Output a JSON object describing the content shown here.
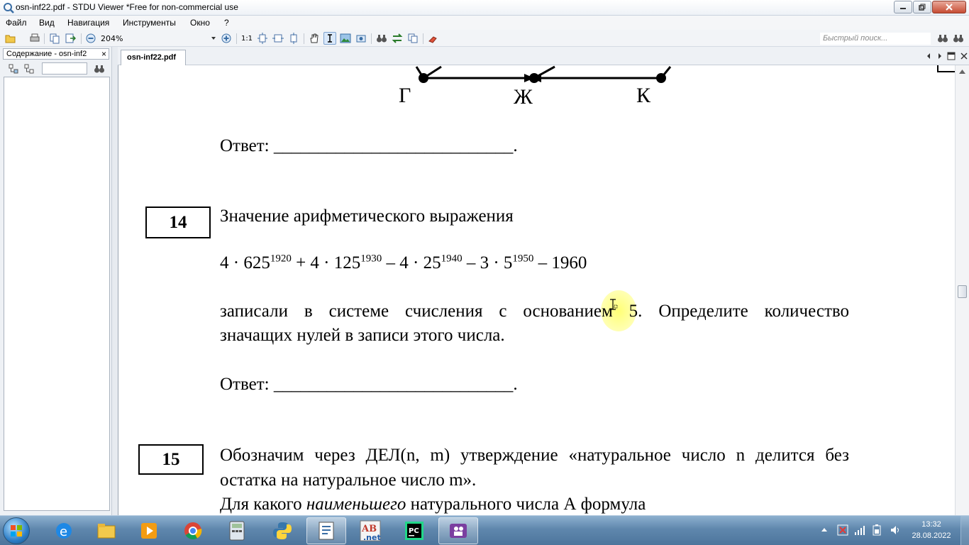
{
  "window": {
    "title": "osn-inf22.pdf - STDU Viewer *Free for non-commercial use"
  },
  "menu": {
    "items": [
      "Файл",
      "Вид",
      "Навигация",
      "Инструменты",
      "Окно",
      "?"
    ]
  },
  "toolbar": {
    "zoom": "204%",
    "actual_size": "1:1",
    "search_placeholder": "Быстрый поиск..."
  },
  "sidebar": {
    "tab_label": "Содержание - osn-inf2"
  },
  "document": {
    "tab_label": "osn-inf22.pdf",
    "graph_labels": [
      "Г",
      "Ж",
      "К"
    ],
    "answer_label_1": "Ответ: ",
    "answer_line_1": "___________________________.",
    "task14": {
      "number": "14",
      "title": "Значение арифметического выражения",
      "expr": {
        "p1": "4 · 625",
        "e1": "1920",
        "p2": " + 4 · 125",
        "e2": "1930",
        "p3": " – 4 · 25",
        "e3": "1940",
        "p4": " – 3 · 5",
        "e4": "1950",
        "p5": " – 1960"
      },
      "line1": "записали в системе счисления с основанием 5. Определите количество",
      "line2": "значащих нулей в записи этого числа."
    },
    "answer_label_2": "Ответ: ",
    "answer_line_2": "___________________________.",
    "task15": {
      "number": "15",
      "line1": "Обозначим через ДЕЛ(n, m) утверждение «натуральное число n делится без",
      "line2": "остатка на натуральное число m».",
      "line3_a": "Для какого ",
      "line3_b": "наименьшего",
      "line3_c": " натурального числа А формула"
    }
  },
  "taskbar": {
    "time": "13:32",
    "date": "28.08.2022"
  },
  "colors": {
    "taskbar": "#5f87ad",
    "highlight": "#ffff6e",
    "page": "#ffffff"
  }
}
